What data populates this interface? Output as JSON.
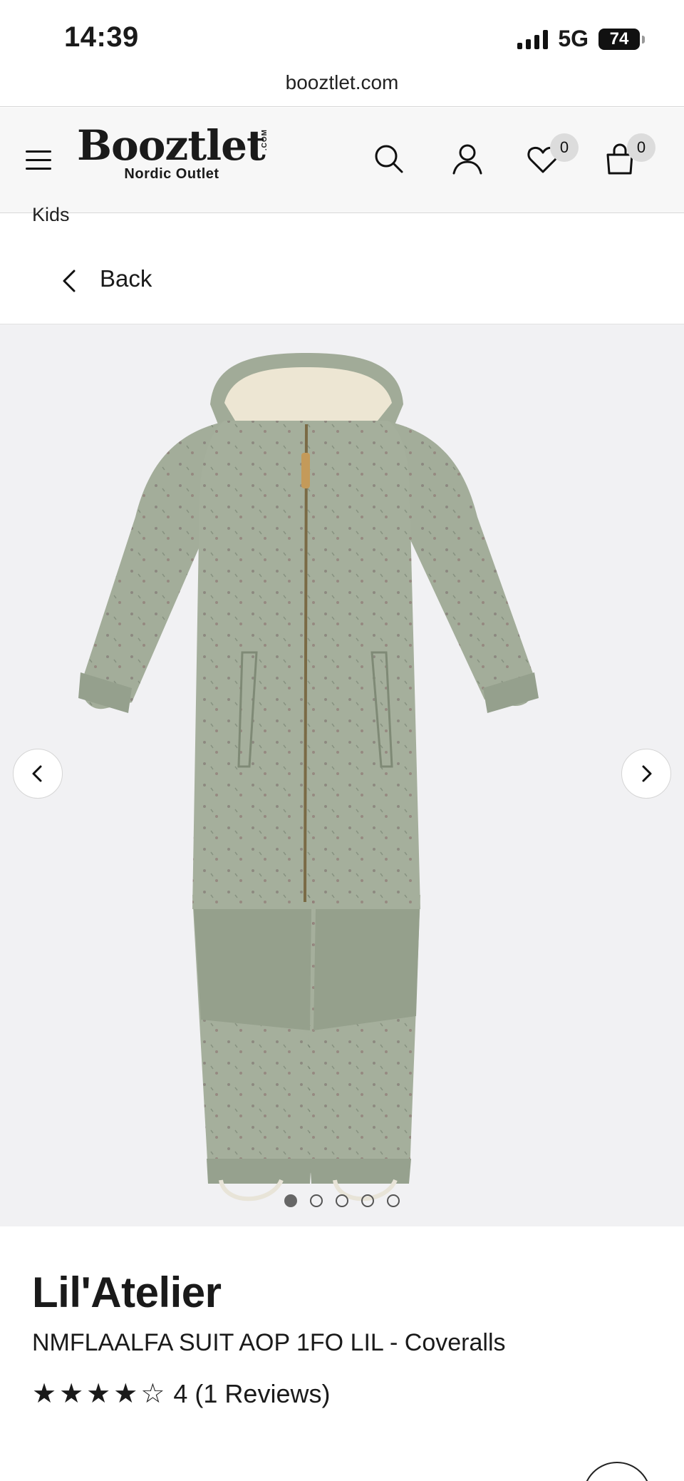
{
  "status_bar": {
    "time": "14:39",
    "network": "5G",
    "battery": "74"
  },
  "browser": {
    "url": "booztlet.com"
  },
  "header": {
    "logo_word": "Booztlet",
    "logo_com": ".COM",
    "logo_tagline": "Nordic Outlet",
    "wishlist_count": "0",
    "cart_count": "0"
  },
  "breadcrumb": {
    "label": "Kids"
  },
  "nav": {
    "back_label": "Back"
  },
  "gallery": {
    "image_count": 5,
    "active_index": 0
  },
  "product": {
    "brand": "Lil'Atelier",
    "name": "NMFLAALFA SUIT AOP 1FO LIL - Coveralls",
    "rating": 4,
    "rating_max": 5,
    "rating_text": "4 (1 Reviews)"
  },
  "colors": {
    "accent": "#111111",
    "header_bg": "#f7f7f7",
    "gallery_bg": "#f1f1f3",
    "product_green": "#a3ad9a"
  }
}
